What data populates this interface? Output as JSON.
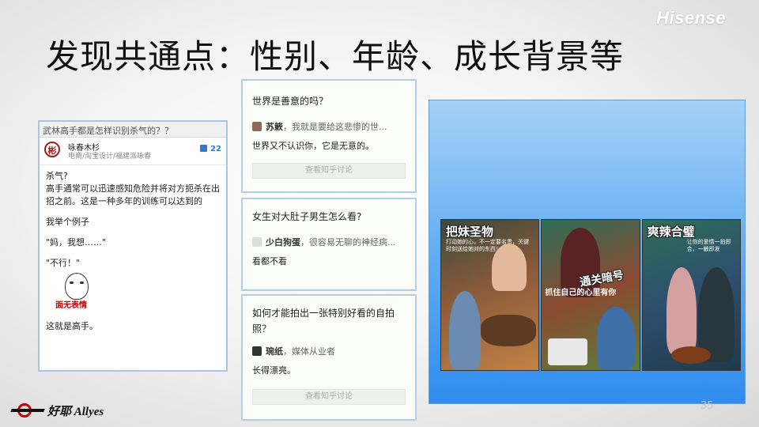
{
  "brand": "Hisense",
  "title": "发现共通点：性别、年龄、成长背景等",
  "page_number": "35",
  "footer_logo": "好耶 Allyes",
  "left_card": {
    "question": "武林高手都是怎样识别杀气的？？",
    "author_name": "咏春木杉",
    "author_desc": "电商/淘宝设计/福建派咏春",
    "votes": "22",
    "paragraphs": [
      "杀气?",
      "高手通常可以迅速感知危险并将对方扼杀在出招之前。这是一种多年的训练可以达到的",
      "我举个例子",
      "\"妈，我想……\"",
      "\"不行！\""
    ],
    "image_caption": "面无表情",
    "closing": "这就是高手。"
  },
  "middle_cards": [
    {
      "question": "世界是善意的吗？",
      "answerer": "苏簌",
      "answerer_desc": "，我就是要给这悲惨的世...",
      "answer": "世界又不认识你，它是无意的。",
      "button": "查看知乎讨论"
    },
    {
      "question": "女生对大肚子男生怎么看?",
      "answerer": "少白狗蛋",
      "answerer_desc": "，很容易无聊的神经病...",
      "answer": "看都不看"
    },
    {
      "question": "如何才能拍出一张特别好看的自拍照？",
      "answerer": "琬纸",
      "answerer_desc": "，媒体从业者",
      "answer": "长得漂亮。",
      "button": "查看知乎讨论"
    }
  ],
  "comics": [
    {
      "title": "把妹圣物",
      "subtitle": "打动她的心，不一定要名贵，关键时刻送给她对的东西！"
    },
    {
      "title": "通关暗号",
      "subtitle": "抓住自己的心里有你"
    },
    {
      "title": "爽辣合璧",
      "subtitle": "让你的爱情一拍即合，一触即发"
    }
  ],
  "colors": {
    "panel_top": "#a6d1f7",
    "panel_bottom": "#2f8cef",
    "accent_blue": "#2e7bcf",
    "logo_red": "#c40000"
  }
}
